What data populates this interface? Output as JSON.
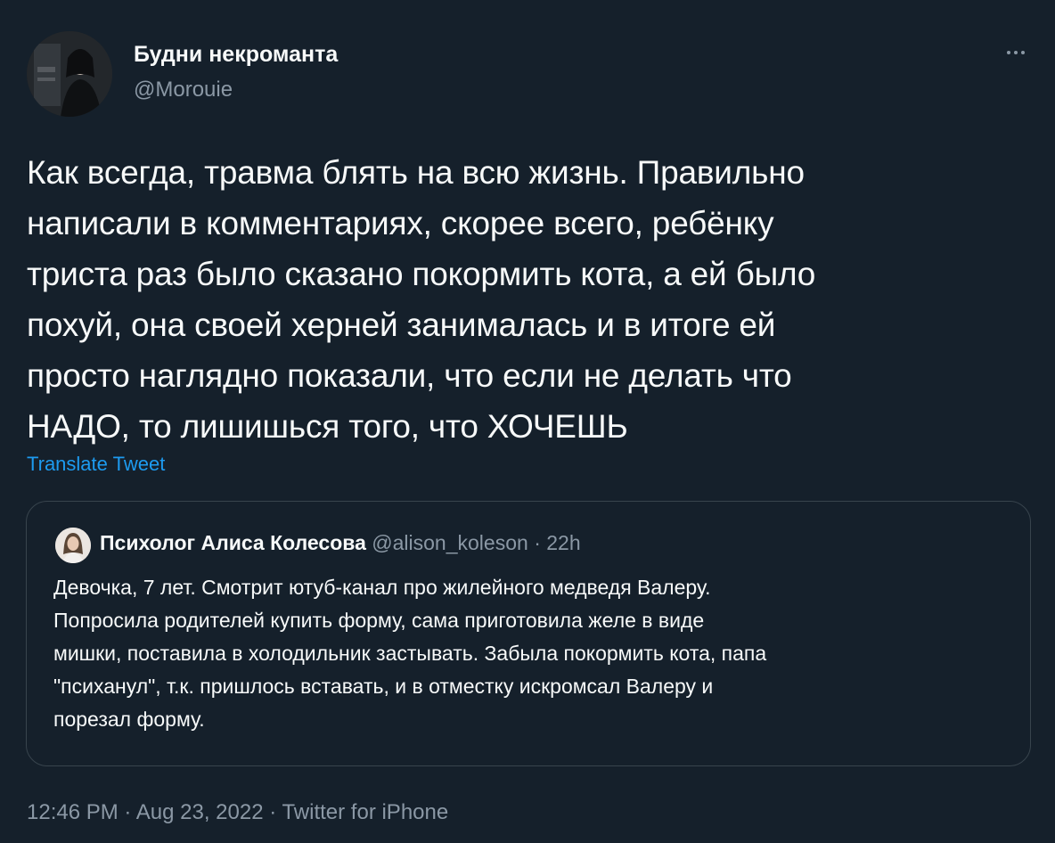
{
  "tweet": {
    "author": {
      "display_name": "Будни некроманта",
      "handle": "@Morouie"
    },
    "text_lines": [
      "Как всегда, травма блять на всю жизнь. Правильно",
      "написали в комментариях, скорее всего, ребёнку",
      "триста раз было сказано покормить кота, а ей было",
      "похуй, она своей херней занималась и в итоге ей",
      "просто наглядно показали, что если не делать что",
      "НАДО, то лишишься того, что ХОЧЕШЬ"
    ],
    "translate_label": "Translate Tweet",
    "quoted": {
      "display_name": "Психолог Алиса Колесова",
      "handle": "@alison_koleson",
      "separator": "·",
      "time": "22h",
      "text_lines": [
        "Девочка, 7 лет. Смотрит ютуб-канал про жилейного медведя Валеру.",
        "Попросила родителей купить форму, сама приготовила желе в виде",
        "мишки, поставила в холодильник застывать. Забыла покормить кота, папа",
        "\"психанул\", т.к. пришлось вставать, и в отместку искромсал Валеру и",
        "порезал форму."
      ]
    },
    "meta": {
      "time": "12:46 PM",
      "separator": "·",
      "date": "Aug 23, 2022",
      "source": "Twitter for iPhone"
    }
  },
  "icons": {
    "more": "more-horizontal-icon"
  },
  "colors": {
    "background": "#15202b",
    "text": "#f7f9f9",
    "secondary_text": "#8b98a5",
    "link": "#1d9bf0",
    "border": "#38444d"
  }
}
